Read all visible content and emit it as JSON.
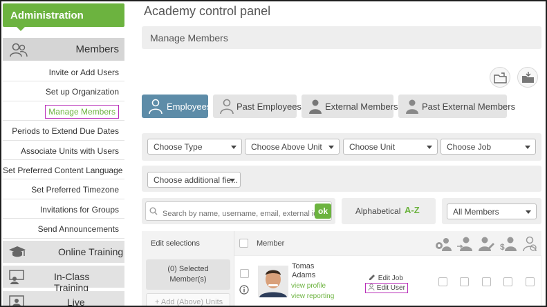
{
  "sidebar": {
    "header": "Administration",
    "members_section": "Members",
    "items": [
      {
        "label": "Invite or Add Users",
        "active": false
      },
      {
        "label": "Set up Organization",
        "active": false
      },
      {
        "label": "Manage Members",
        "active": true
      },
      {
        "label": "Periods to Extend Due Dates",
        "active": false
      },
      {
        "label": "Associate Units with Users",
        "active": false
      },
      {
        "label": "Set Preferred Content Language",
        "active": false
      },
      {
        "label": "Set Preferred Timezone",
        "active": false
      },
      {
        "label": "Invitations for Groups",
        "active": false
      },
      {
        "label": "Send Announcements",
        "active": false
      }
    ],
    "sections": [
      {
        "label": "Online Training",
        "icon": "graduation-cap-icon"
      },
      {
        "label": "In-Class Training",
        "icon": "classroom-icon"
      },
      {
        "label": "Live Sessions",
        "icon": "presentation-icon"
      }
    ]
  },
  "main": {
    "title": "Academy control panel",
    "subtitle": "Manage Members",
    "tabs": [
      {
        "label": "Employees",
        "active": true
      },
      {
        "label": "Past Employees",
        "active": false
      },
      {
        "label": "External Members",
        "active": false
      },
      {
        "label": "Past External Members",
        "active": false
      }
    ],
    "filters": {
      "type": "Choose Type",
      "above_unit": "Choose Above Unit",
      "unit": "Choose Unit",
      "job": "Choose Job",
      "additional": "Choose additional fie..."
    },
    "search": {
      "placeholder": "Search by name, username, email, external id, E",
      "ok": "ok"
    },
    "sort": {
      "label": "Alphabetical",
      "az": "A-Z"
    },
    "members_filter": "All Members",
    "table": {
      "edit_selections": "Edit selections",
      "member_col": "Member",
      "selected_count": "(0) Selected",
      "selected_suffix": "Member(s)",
      "add_units": "+ Add (Above) Units",
      "row": {
        "first_name": "Tomas",
        "last_name": "Adams",
        "view_profile": "view profile",
        "view_reporting": "view reporting",
        "edit_job": "Edit Job",
        "edit_user": "Edit User"
      }
    }
  },
  "colors": {
    "brand_green": "#6cb33f",
    "active_tab": "#5d8ca8",
    "highlight": "#b92fb9"
  }
}
